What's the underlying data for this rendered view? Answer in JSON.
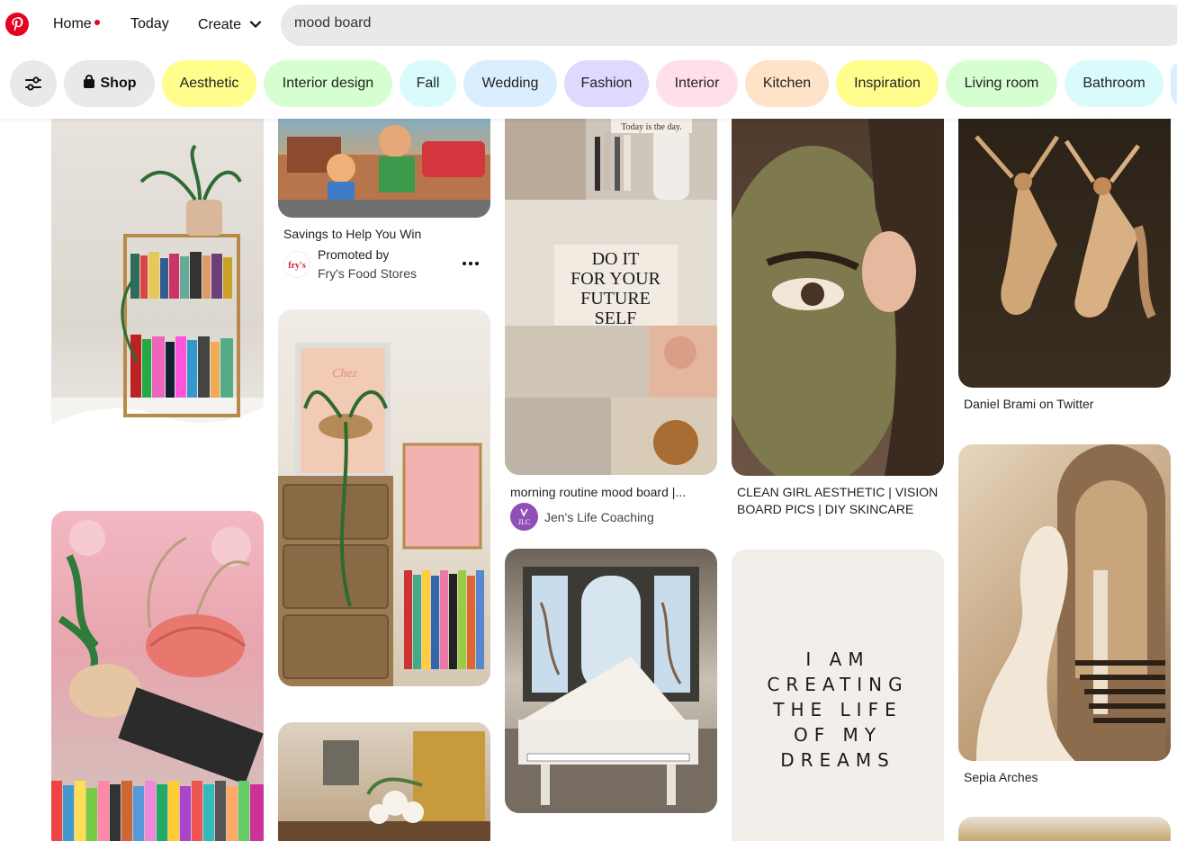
{
  "nav": {
    "home": "Home",
    "today": "Today",
    "create": "Create"
  },
  "search": {
    "value": "mood board"
  },
  "chips": [
    {
      "label": "Shop",
      "color": "#e9e9e9"
    },
    {
      "label": "Aesthetic",
      "color": "#fffd8c"
    },
    {
      "label": "Interior design",
      "color": "#d5ffd0"
    },
    {
      "label": "Fall",
      "color": "#d9fbfb"
    },
    {
      "label": "Wedding",
      "color": "#dbeeff"
    },
    {
      "label": "Fashion",
      "color": "#e0d9ff"
    },
    {
      "label": "Interior",
      "color": "#ffe0ea"
    },
    {
      "label": "Kitchen",
      "color": "#ffe3c8"
    },
    {
      "label": "Inspiration",
      "color": "#fffd8c"
    },
    {
      "label": "Living room",
      "color": "#d5ffd0"
    },
    {
      "label": "Bathroom",
      "color": "#d9fbfb"
    }
  ],
  "pins": {
    "savings": {
      "title": "Savings to Help You Win",
      "promoted": "Promoted by",
      "brand": "Fry's Food Stores"
    },
    "routine": {
      "title": "morning routine mood board |...",
      "author": "Jen's Life Coaching",
      "collage_top": "Today is the day.",
      "collage_quote": "DO IT FOR YOUR FUTURE SELF"
    },
    "clean_girl": {
      "title_line1": "CLEAN GIRL AESTHETIC | VISION",
      "title_line2": "BOARD PICS | DIY SKINCARE"
    },
    "dancers": {
      "title": "Daniel Brami on Twitter"
    },
    "arches": {
      "title": "Sepia Arches"
    },
    "quote": {
      "lines": [
        "I AM",
        "CREATING",
        "THE LIFE",
        "OF MY",
        "DREAMS"
      ]
    }
  },
  "colors": {
    "brand": "#e60023"
  },
  "icons": [
    "pinterest-logo-icon",
    "chevron-down-icon",
    "filter-sliders-icon",
    "shopping-bag-icon",
    "more-options-icon"
  ]
}
